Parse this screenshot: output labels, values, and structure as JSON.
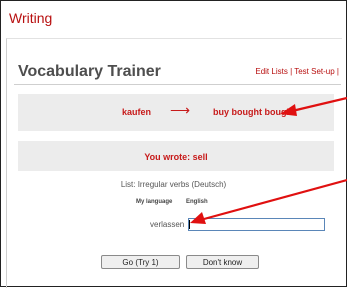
{
  "section": {
    "title": "Writing"
  },
  "header": {
    "app_title": "Vocabulary Trainer",
    "links": [
      "Edit Lists",
      "|",
      "Test Set-up",
      "|"
    ]
  },
  "translation": {
    "source_word": "kaufen",
    "arrow": "⟶",
    "target_word": "buy bought bought"
  },
  "feedback": {
    "text": "You wrote: sell"
  },
  "list": {
    "name": "List: Irregular verbs (Deutsch)",
    "my_language_label": "My language",
    "target_language_label": "English"
  },
  "exercise": {
    "prompt_word": "verlassen",
    "answer_value": ""
  },
  "buttons": {
    "go_label": "Go (Try 1)",
    "dont_know_label": "Don't know"
  },
  "colors": {
    "accent": "#b80f0f",
    "feedback_box": "#ececec",
    "annotation_arrow": "#e01010"
  }
}
